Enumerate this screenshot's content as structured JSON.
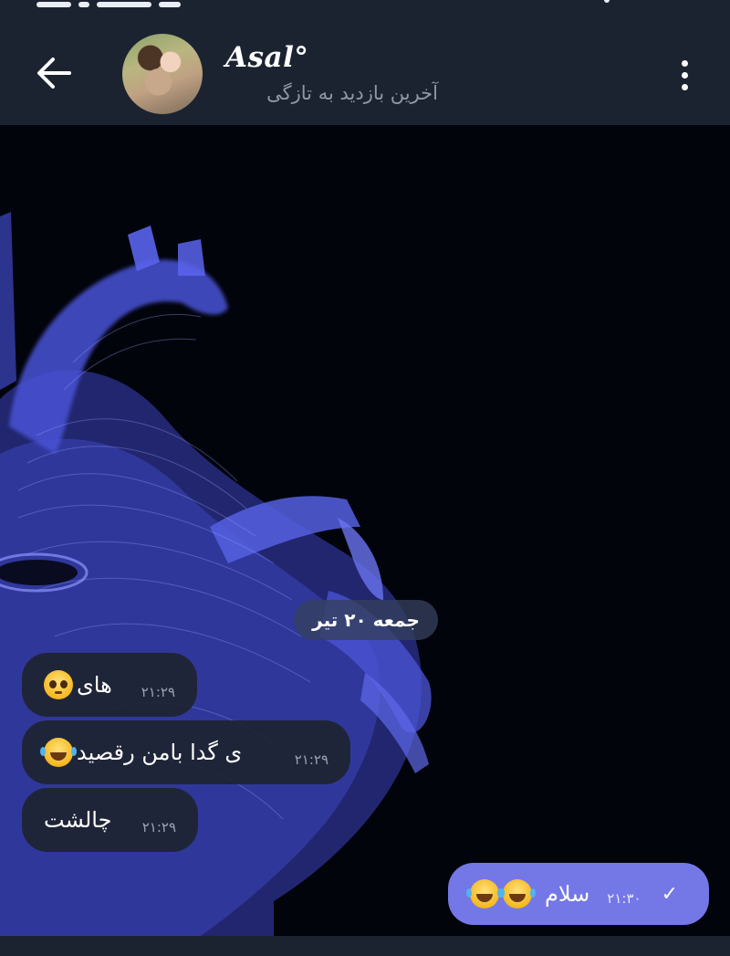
{
  "header": {
    "contact_name": "Asal°",
    "last_seen": "آخرین بازدید به تازگی"
  },
  "chat": {
    "date_label": "جمعه ۲۰ تیر",
    "messages": [
      {
        "text": "های",
        "time": "۲۱:۲۹",
        "emoji": [
          "pleading-face"
        ],
        "direction": "incoming"
      },
      {
        "text": "ی گدا بامن رقصید",
        "time": "۲۱:۲۹",
        "emoji": [
          "face-with-tears-of-joy"
        ],
        "direction": "incoming"
      },
      {
        "text": "چالشت",
        "time": "۲۱:۲۹",
        "emoji": [],
        "direction": "incoming"
      },
      {
        "text": "سلام",
        "time": "۲۱:۳۰",
        "emoji": [
          "face-with-tears-of-joy",
          "face-with-tears-of-joy"
        ],
        "direction": "outgoing",
        "status": "sent-check"
      }
    ]
  },
  "icons": {
    "back": "arrow-left-icon",
    "menu": "vertical-dots-icon",
    "check": "check-icon"
  },
  "colors": {
    "header_bg": "#1c2330",
    "incoming_bubble": "#1e2430",
    "outgoing_bubble": "#7477e6",
    "wallpaper_glow": "#5b66e8"
  }
}
